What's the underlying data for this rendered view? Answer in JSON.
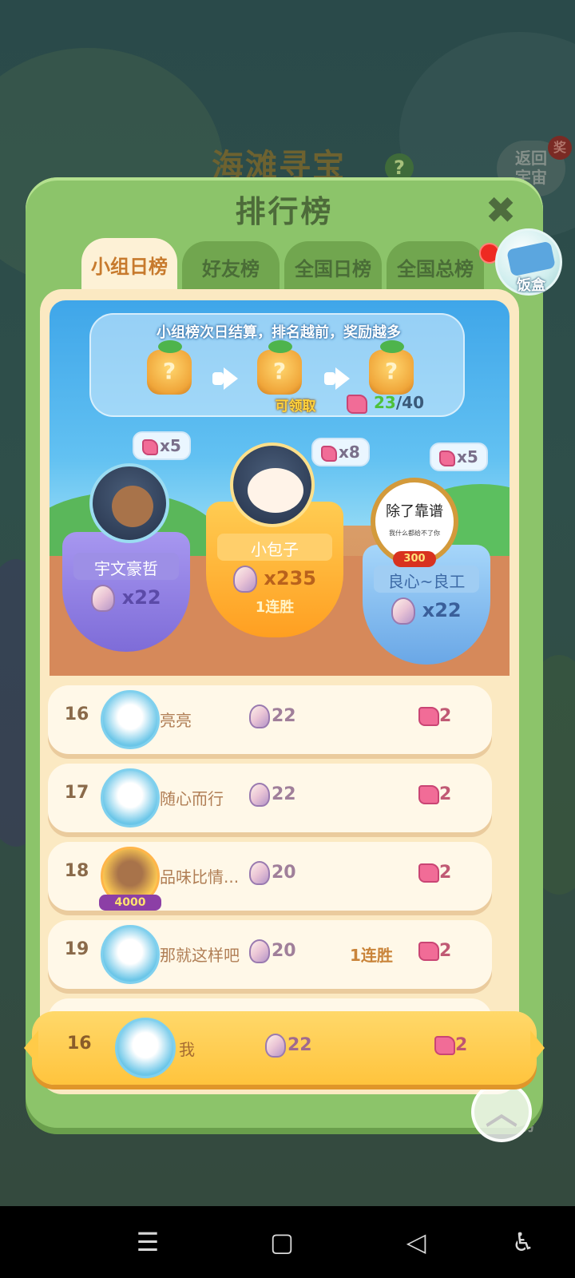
{
  "background": {
    "game_title": "海滩寻宝",
    "help_icon": "question-icon",
    "return_button": "返回\n宇宙",
    "return_badge": "奖",
    "rank_label": "榜"
  },
  "modal": {
    "title": "排行榜",
    "close_icon": "close-icon",
    "tabs": [
      {
        "label": "小组日榜",
        "active": true
      },
      {
        "label": "好友榜",
        "active": false
      },
      {
        "label": "全国日榜",
        "active": false
      },
      {
        "label": "全国总榜",
        "active": false
      }
    ],
    "lunchbox_label": "饭盒"
  },
  "info": {
    "text": "小组榜次日结算，排名越前，奖励越多",
    "claim_label": "可领取",
    "progress_current": "23",
    "progress_total": "/40"
  },
  "podium": [
    {
      "place": 2,
      "bubble": "x5",
      "name": "宇文豪哲",
      "shells": "x22",
      "extra": ""
    },
    {
      "place": 1,
      "bubble": "x8",
      "name": "小包子",
      "shells": "x235",
      "extra": "1连胜"
    },
    {
      "place": 3,
      "bubble": "x5",
      "name": "良心~良工",
      "shells": "x22",
      "extra": "",
      "frame_text": "除了靠谱",
      "frame_subtext": "我什么都给不了你",
      "frame_badge": "300"
    }
  ],
  "rows": [
    {
      "rank": "16",
      "name": "亮亮",
      "shells": "22",
      "streak": "",
      "flags": "2"
    },
    {
      "rank": "17",
      "name": "随心而行",
      "shells": "22",
      "streak": "",
      "flags": "2"
    },
    {
      "rank": "18",
      "name": "品味比情...",
      "shells": "20",
      "streak": "",
      "flags": "2",
      "badge": "4000"
    },
    {
      "rank": "19",
      "name": "那就这样吧",
      "shells": "20",
      "streak": "1连胜",
      "flags": "2"
    }
  ],
  "self_row": {
    "rank": "16",
    "name": "我",
    "shells": "22",
    "flags": "2"
  },
  "colors": {
    "modal_green": "#8cc46a",
    "panel_cream": "#fbe9c2",
    "gold": "#ffc43d",
    "pillar_purple": "#8f7ee0",
    "pillar_orange": "#ffb12f",
    "pillar_blue": "#7ab8f0"
  },
  "navbar": {
    "menu_icon": "menu-icon",
    "home_icon": "home-icon",
    "back_icon": "back-icon",
    "accessibility_icon": "accessibility-icon"
  }
}
